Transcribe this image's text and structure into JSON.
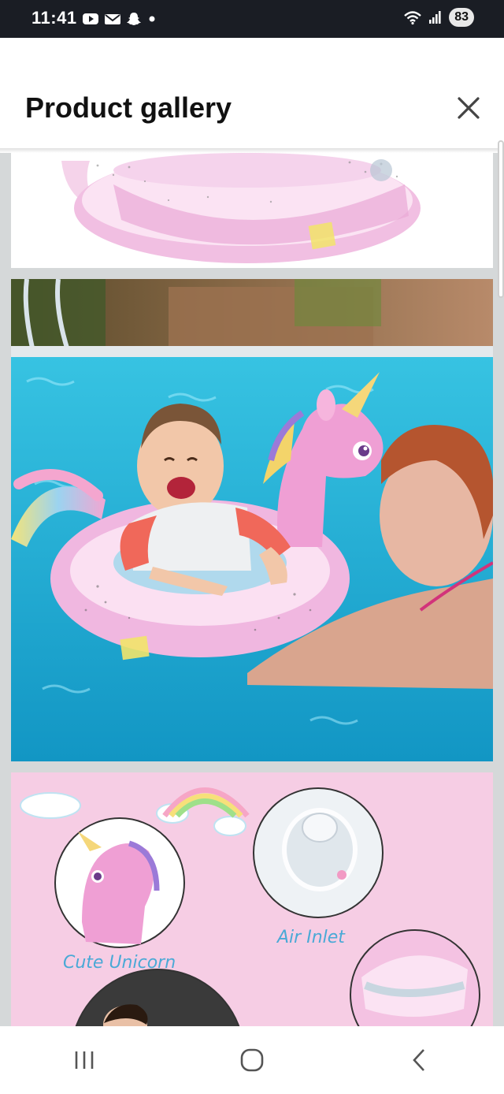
{
  "status_bar": {
    "time": "11:41",
    "battery": "83",
    "left_icons": [
      "youtube-icon",
      "mail-icon",
      "snapchat-icon",
      "dot-icon"
    ],
    "right_icons": [
      "wifi-icon",
      "signal-icon",
      "battery-icon"
    ]
  },
  "header": {
    "title": "Product gallery",
    "close_icon": "close-icon"
  },
  "gallery": {
    "images": [
      {
        "description_name": "unicorn-float-top-image"
      },
      {
        "description_name": "baby-in-pool-image"
      },
      {
        "description_name": "features-illustration-image",
        "labels": {
          "cute_unicorn": "Cute Unicorn",
          "air_inlet": "Air Inlet"
        }
      }
    ]
  },
  "nav_bar": {
    "recents_icon": "recents-icon",
    "home_icon": "home-icon",
    "back_icon": "back-icon"
  },
  "colors": {
    "status_bar_bg": "#1a1d24",
    "gallery_bg": "#d5d8d9",
    "pool_blue": "#2bb5d8",
    "float_pink": "#f0b7e0",
    "illustration_pink": "#f6cde4",
    "caption_blue": "#4aa9d6"
  }
}
